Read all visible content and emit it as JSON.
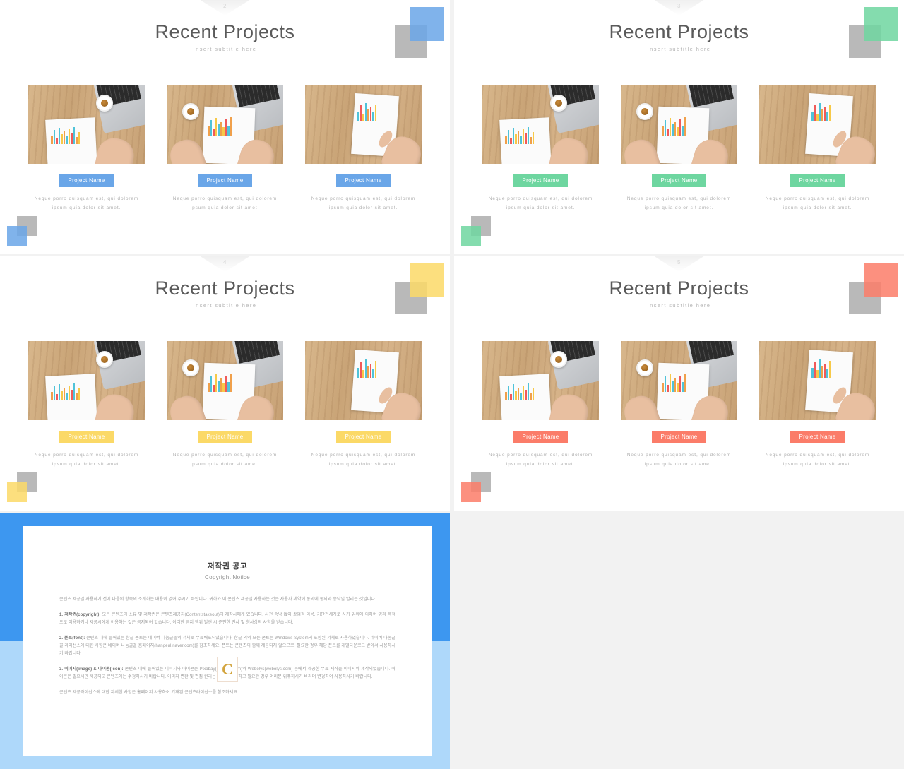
{
  "deck": {
    "background_color": "#f2f2f2",
    "slides": [
      {
        "page_number": "2",
        "accent_color": "#6aa6e8",
        "title": "Recent Projects",
        "subtitle": "Insert subtitle here",
        "cards": [
          {
            "pill_label": "Project Name",
            "description": "Neque porro quisquam est, qui dolorem ipsum quia dolor sit amet.",
            "image_alt": "desk-with-chart-report-coffee-laptop"
          },
          {
            "pill_label": "Project Name",
            "description": "Neque porro quisquam est, qui dolorem ipsum quia dolor sit amet.",
            "image_alt": "hands-pointing-at-chart-report"
          },
          {
            "pill_label": "Project Name",
            "description": "Neque porro quisquam est, qui dolorem ipsum quia dolor sit amet.",
            "image_alt": "finger-pointing-at-chart-page"
          }
        ]
      },
      {
        "page_number": "3",
        "accent_color": "#6ed6a0",
        "title": "Recent Projects",
        "subtitle": "Insert subtitle here",
        "cards": [
          {
            "pill_label": "Project Name",
            "description": "Neque porro quisquam est, qui dolorem ipsum quia dolor sit amet.",
            "image_alt": "desk-with-chart-report-coffee-laptop"
          },
          {
            "pill_label": "Project Name",
            "description": "Neque porro quisquam est, qui dolorem ipsum quia dolor sit amet.",
            "image_alt": "hands-pointing-at-chart-report"
          },
          {
            "pill_label": "Project Name",
            "description": "Neque porro quisquam est, qui dolorem ipsum quia dolor sit amet.",
            "image_alt": "finger-pointing-at-chart-page"
          }
        ]
      },
      {
        "page_number": "4",
        "accent_color": "#fbd967",
        "title": "Recent Projects",
        "subtitle": "Insert subtitle here",
        "cards": [
          {
            "pill_label": "Project Name",
            "description": "Neque porro quisquam est, qui dolorem ipsum quia dolor sit amet.",
            "image_alt": "desk-with-chart-report-coffee-laptop"
          },
          {
            "pill_label": "Project Name",
            "description": "Neque porro quisquam est, qui dolorem ipsum quia dolor sit amet.",
            "image_alt": "hands-pointing-at-chart-report"
          },
          {
            "pill_label": "Project Name",
            "description": "Neque porro quisquam est, qui dolorem ipsum quia dolor sit amet.",
            "image_alt": "finger-pointing-at-chart-page"
          }
        ]
      },
      {
        "page_number": "5",
        "accent_color": "#fb7c69",
        "title": "Recent Projects",
        "subtitle": "Insert subtitle here",
        "cards": [
          {
            "pill_label": "Project Name",
            "description": "Neque porro quisquam est, qui dolorem ipsum quia dolor sit amet.",
            "image_alt": "desk-with-chart-report-coffee-laptop"
          },
          {
            "pill_label": "Project Name",
            "description": "Neque porro quisquam est, qui dolorem ipsum quia dolor sit amet.",
            "image_alt": "hands-pointing-at-chart-report"
          },
          {
            "pill_label": "Project Name",
            "description": "Neque porro quisquam est, qui dolorem ipsum quia dolor sit amet.",
            "image_alt": "finger-pointing-at-chart-page"
          }
        ]
      }
    ]
  },
  "copyright": {
    "band_top_color": "#3d97f0",
    "band_bottom_color": "#aed8fa",
    "title_ko": "저작권 공고",
    "title_en": "Copyright Notice",
    "watermark_letter": "C",
    "intro": "콘텐츠 제공일 사용하기 전에 다음의 항목의 소개하는 내용이 없어 주시기 바랍니다. 귀하가 이 콘텐츠 제공일 사용하는 것은 사용자 계약에 동의에 동의와 승낙일 알리는 것입니다.",
    "item1_heading": "1. 저작권(copyright):",
    "item1_body": "모든 콘텐츠의 소유 및 저작권은 콘텐츠제공자(Contentstakeout)의 제작사에게 있습니다. 사전 승낙 없이 상업적 이용, 기단전세계로 사기 임의에 의하여 영리 목적으로 이용하거나 제공시에게 이용하는 것은 금지되어 있습니다. 이러한 금지 행위 발견 시 준인한 민사 및 형사상의 사항을 받습니다.",
    "item2_heading": "2. 폰트(font):",
    "item2_body": "콘텐츠 내에 들어있는 한글 폰트는 네이버 나눔글꼴의 서체로 무료배포되었습니다. 한글 외의 모든 폰트는 Windows System의 포함된 서체로 사용하였습니다. 네이버 나눔글꼴 라이선스에 대한 사항은 네이버 나눔글꼴 홈페이지(hangeul.naver.com)를 참조하세요. 폰트는 콘텐츠의 함께 제공되지 않으므로, 필요한 경우 해당 폰트를 개별다운로드 받아서 사용하시기 바랍니다.",
    "item3_heading": "3. 이미지(image) & 아이콘(icon):",
    "item3_body": "콘텐츠 내에 들어있는 이미지와 아이콘은 Pixabay(pixabay.com)와 Webolys(webolys.com) 등에서 제공한 무료 저작물 이미지와 제작되었습니다. 아이콘은 필요시만 제공되고 콘텐츠에는 수정하시기 바랍니다. 이미지 변환 및 편집 권리는 귀하가 확인하고 필요한 경우 여러분 위주하시기 바라며 변경하여 사용하시기 바랍니다.",
    "footer": "콘텐츠 제공라이선스에 대한 자세한 사항은 홈페이지 사용하여 기재된 콘텐츠라이선스를 참조하세요"
  }
}
